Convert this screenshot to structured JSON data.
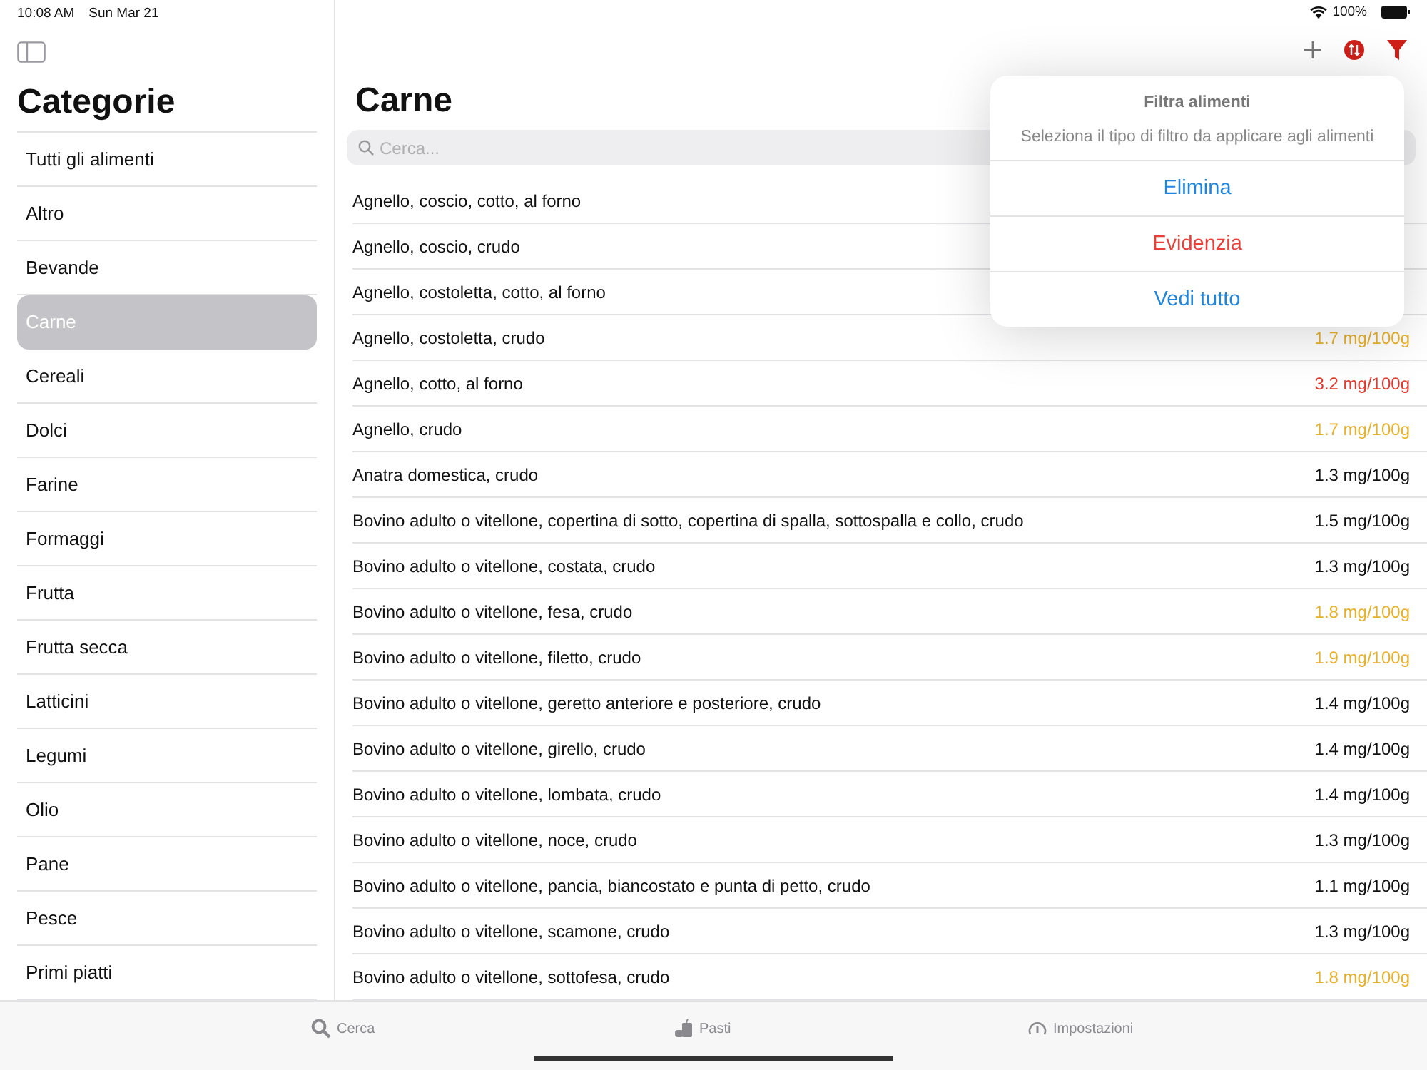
{
  "status_bar": {
    "time": "10:08 AM",
    "date": "Sun Mar 21",
    "battery": "100%"
  },
  "sidebar": {
    "title": "Categorie",
    "items": [
      {
        "label": "Tutti gli alimenti",
        "selected": false
      },
      {
        "label": "Altro",
        "selected": false
      },
      {
        "label": "Bevande",
        "selected": false
      },
      {
        "label": "Carne",
        "selected": true
      },
      {
        "label": "Cereali",
        "selected": false
      },
      {
        "label": "Dolci",
        "selected": false
      },
      {
        "label": "Farine",
        "selected": false
      },
      {
        "label": "Formaggi",
        "selected": false
      },
      {
        "label": "Frutta",
        "selected": false
      },
      {
        "label": "Frutta secca",
        "selected": false
      },
      {
        "label": "Latticini",
        "selected": false
      },
      {
        "label": "Legumi",
        "selected": false
      },
      {
        "label": "Olio",
        "selected": false
      },
      {
        "label": "Pane",
        "selected": false
      },
      {
        "label": "Pesce",
        "selected": false
      },
      {
        "label": "Primi piatti",
        "selected": false
      }
    ]
  },
  "main": {
    "title": "Carne",
    "search": {
      "placeholder": "Cerca..."
    },
    "rows": [
      {
        "name": "Agnello, coscio, cotto, al forno"
      },
      {
        "name": "Agnello, coscio, crudo"
      },
      {
        "name": "Agnello, costoletta, cotto, al forno"
      },
      {
        "name": "Agnello, costoletta, crudo",
        "value": "1.7 mg/100g",
        "color": "#e8b12a"
      },
      {
        "name": "Agnello, cotto, al forno",
        "value": "3.2 mg/100g",
        "color": "#e5382f"
      },
      {
        "name": "Agnello, crudo",
        "value": "1.7 mg/100g",
        "color": "#e8b12a"
      },
      {
        "name": "Anatra domestica, crudo",
        "value": "1.3 mg/100g",
        "color": "#111111"
      },
      {
        "name": "Bovino adulto o vitellone, copertina di sotto, copertina di spalla, sottospalla e collo, crudo",
        "value": "1.5 mg/100g",
        "color": "#111111"
      },
      {
        "name": "Bovino adulto o vitellone, costata, crudo",
        "value": "1.3 mg/100g",
        "color": "#111111"
      },
      {
        "name": "Bovino adulto o vitellone, fesa, crudo",
        "value": "1.8 mg/100g",
        "color": "#e8b12a"
      },
      {
        "name": "Bovino adulto o vitellone, filetto, crudo",
        "value": "1.9 mg/100g",
        "color": "#e8b12a"
      },
      {
        "name": "Bovino adulto o vitellone, geretto anteriore e posteriore, crudo",
        "value": "1.4 mg/100g",
        "color": "#111111"
      },
      {
        "name": "Bovino adulto o vitellone, girello, crudo",
        "value": "1.4 mg/100g",
        "color": "#111111"
      },
      {
        "name": "Bovino adulto o vitellone, lombata, crudo",
        "value": "1.4 mg/100g",
        "color": "#111111"
      },
      {
        "name": "Bovino adulto o vitellone, noce, crudo",
        "value": "1.3 mg/100g",
        "color": "#111111"
      },
      {
        "name": "Bovino adulto o vitellone, pancia, biancostato e punta di petto, crudo",
        "value": "1.1 mg/100g",
        "color": "#111111"
      },
      {
        "name": "Bovino adulto o vitellone, scamone, crudo",
        "value": "1.3 mg/100g",
        "color": "#111111"
      },
      {
        "name": "Bovino adulto o vitellone, sottofesa, crudo",
        "value": "1.8 mg/100g",
        "color": "#e8b12a"
      }
    ]
  },
  "popover": {
    "title": "Filtra alimenti",
    "message": "Seleziona il tipo di filtro da applicare agli alimenti",
    "actions": [
      {
        "label": "Elimina",
        "kind": "default"
      },
      {
        "label": "Evidenzia",
        "kind": "destructive"
      },
      {
        "label": "Vedi tutto",
        "kind": "default"
      }
    ]
  },
  "tab_bar": [
    {
      "label": "Cerca"
    },
    {
      "label": "Pasti"
    },
    {
      "label": "Impostazioni"
    }
  ]
}
